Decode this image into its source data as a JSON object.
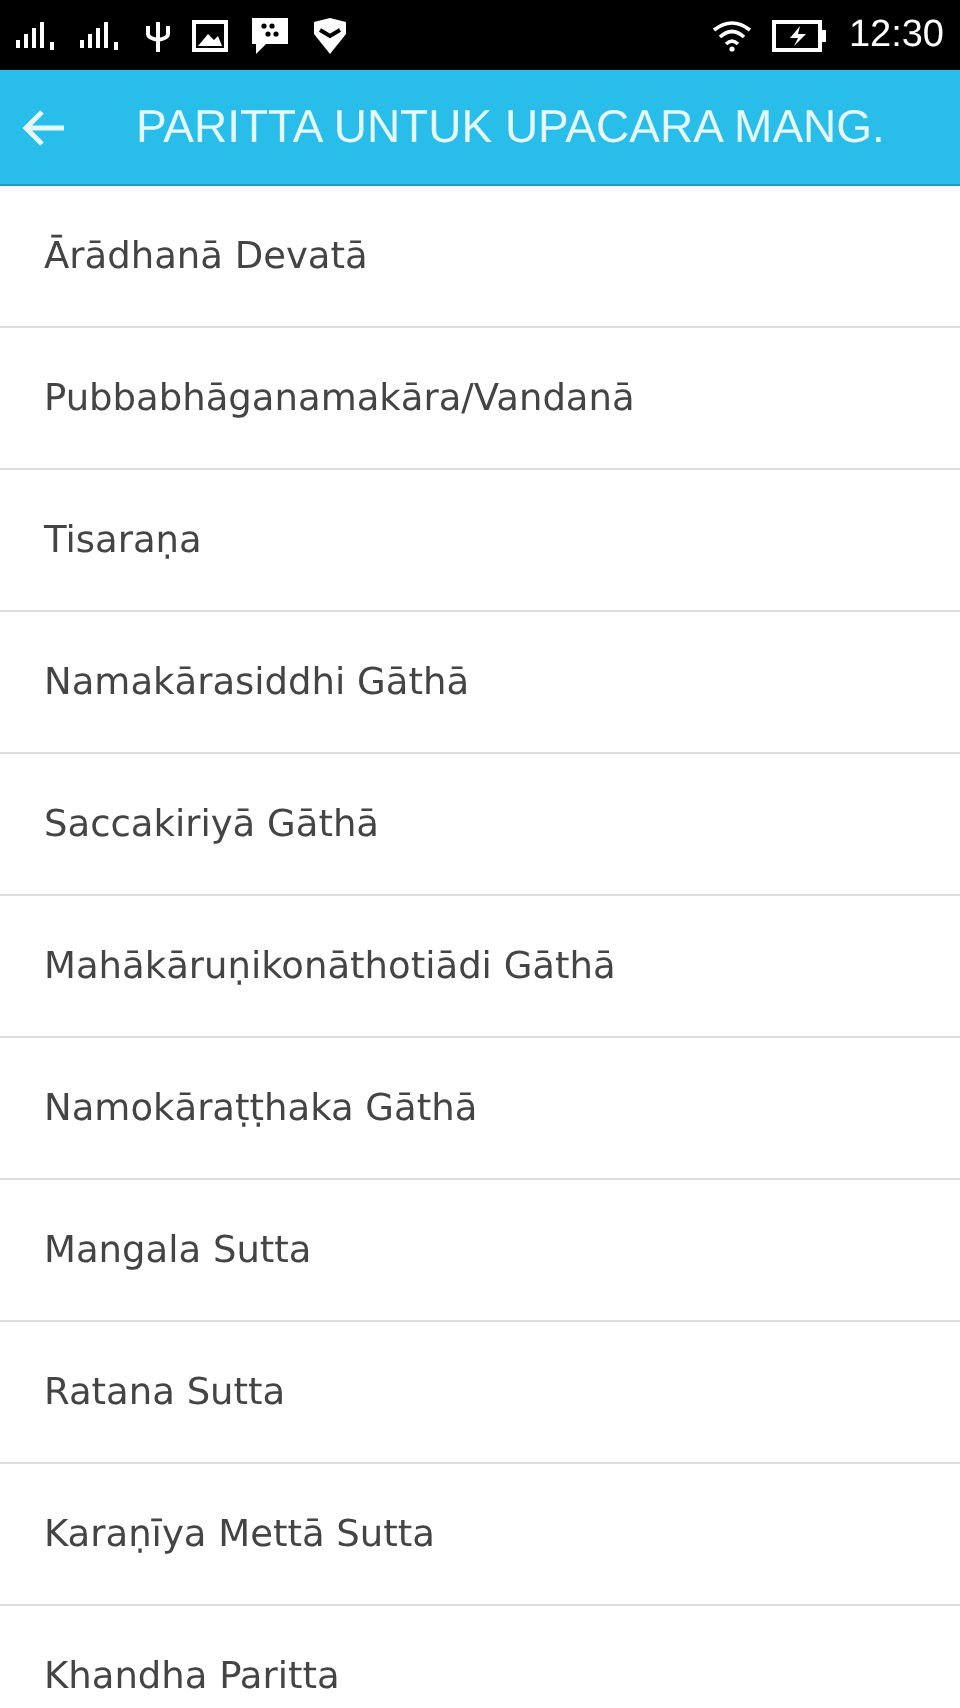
{
  "status_bar": {
    "time": "12:30"
  },
  "app_bar": {
    "title": "PARITTA UNTUK UPACARA MANG."
  },
  "items": [
    {
      "label": "Ārādhanā Devatā"
    },
    {
      "label": "Pubbabhāganamakāra/Vandanā"
    },
    {
      "label": "Tisaraṇa"
    },
    {
      "label": "Namakārasiddhi Gāthā"
    },
    {
      "label": "Saccakiriyā Gāthā"
    },
    {
      "label": "Mahākāruṇikonāthotiādi Gāthā"
    },
    {
      "label": "Namokāraṭṭhaka Gāthā"
    },
    {
      "label": "Mangala Sutta"
    },
    {
      "label": "Ratana Sutta"
    },
    {
      "label": "Karaṇīya Mettā Sutta"
    },
    {
      "label": "Khandha Paritta"
    }
  ]
}
